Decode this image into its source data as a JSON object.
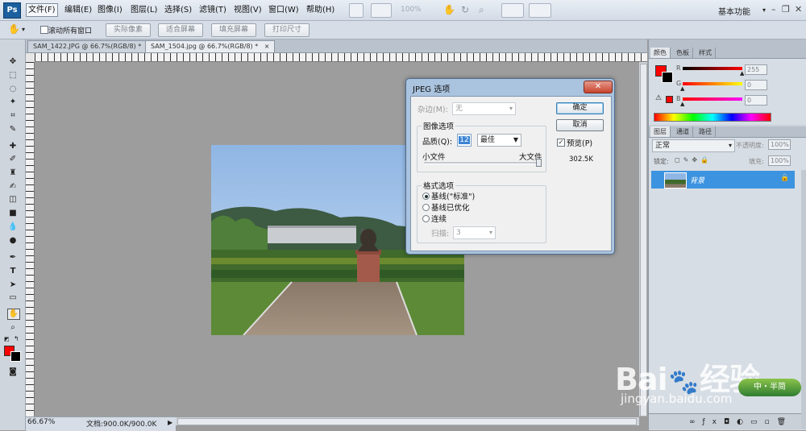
{
  "app": {
    "logo": "Ps"
  },
  "menubar": {
    "items": [
      "文件(F)",
      "编辑(E)",
      "图像(I)",
      "图层(L)",
      "选择(S)",
      "滤镜(T)",
      "视图(V)",
      "窗口(W)",
      "帮助(H)"
    ],
    "zoom_value": "100%",
    "workspace": "基本功能",
    "win_controls": {
      "minimize": "–",
      "restore": "❐",
      "close": "✕"
    }
  },
  "options_bar": {
    "scroll_all_windows_label": "滚动所有窗口",
    "scroll_all_windows_checked": false,
    "buttons": [
      "实际像素",
      "适合屏幕",
      "填充屏幕",
      "打印尺寸"
    ]
  },
  "doc_tabs": [
    {
      "label": "SAM_1422.JPG @ 66.7%(RGB/8) *",
      "close": "×"
    },
    {
      "label": "SAM_1504.jpg @ 66.7%(RGB/8) *",
      "close": "×"
    }
  ],
  "status": {
    "zoom": "66.67%",
    "doc": "文档:900.0K/900.0K"
  },
  "dialog": {
    "title": "JPEG 选项",
    "matte_label": "杂边(M):",
    "matte_value": "无",
    "image_options_title": "图像选项",
    "quality_label": "品质(Q):",
    "quality_value": "12",
    "quality_preset": "最佳",
    "small_file": "小文件",
    "large_file": "大文件",
    "quality_slider_fraction": 1.0,
    "ok": "确定",
    "cancel": "取消",
    "preview_label": "预览(P)",
    "preview_checked": true,
    "file_size": "302.5K",
    "format_options_title": "格式选项",
    "format_options": [
      {
        "label": "基线(\"标准\")",
        "checked": true
      },
      {
        "label": "基线已优化",
        "checked": false
      },
      {
        "label": "连续",
        "checked": false
      }
    ],
    "scans_label": "扫描:",
    "scans_value": "3"
  },
  "color_panel": {
    "tabs": [
      "颜色",
      "色板",
      "样式"
    ],
    "channels": [
      {
        "name": "R",
        "value": "255",
        "color": "#ff0000",
        "fraction": 1.0
      },
      {
        "name": "G",
        "value": "0",
        "color": "#00ff00",
        "fraction": 0.0
      },
      {
        "name": "B",
        "value": "0",
        "color": "#0000ff",
        "fraction": 0.0
      }
    ],
    "foreground": "#ff0000",
    "background": "#000000"
  },
  "layers_panel": {
    "tabs": [
      "图层",
      "通道",
      "路径"
    ],
    "blend_mode": "正常",
    "opacity_label": "不透明度:",
    "opacity_value": "100%",
    "lock_label": "锁定:",
    "fill_label": "填充:",
    "fill_value": "100%",
    "layer_name": "背景"
  },
  "watermark": {
    "brand": "Bai",
    "brand2": "经验",
    "url": "jingyan.baidu.com",
    "badge": "中・半简"
  },
  "colors": {
    "accent": "#3c93e0",
    "fg": "#ff0000"
  }
}
